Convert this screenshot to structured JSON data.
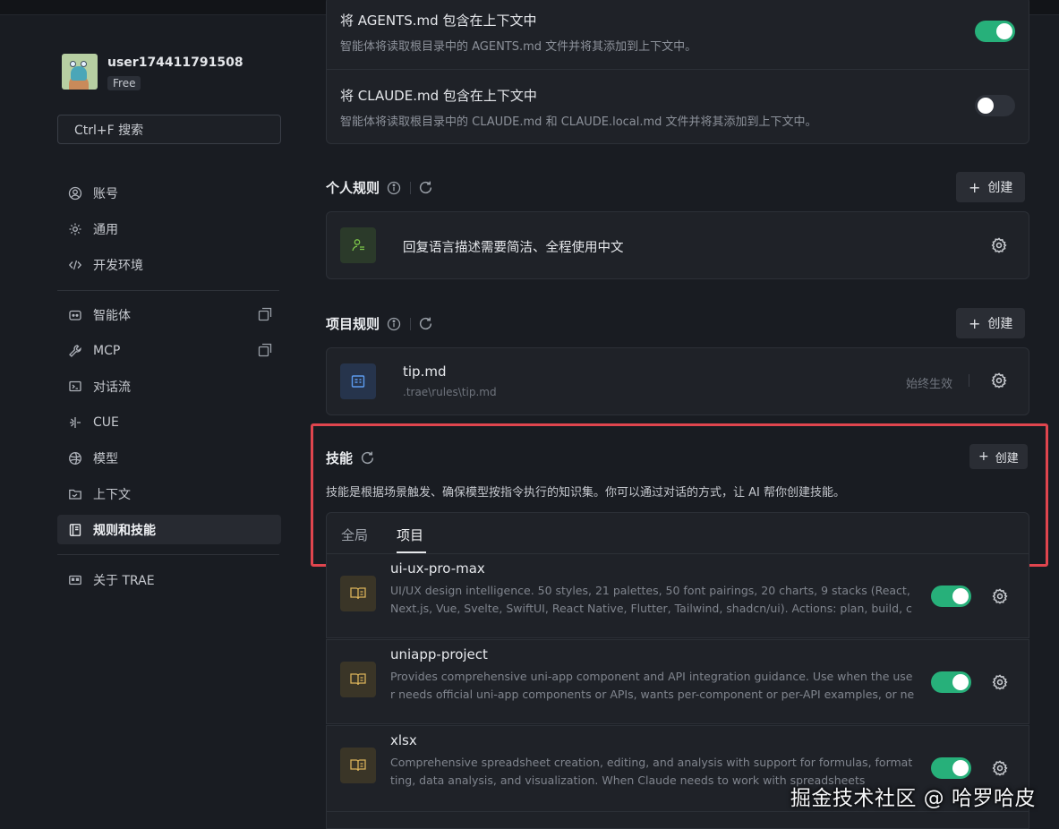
{
  "user": {
    "name": "user174411791508",
    "plan": "Free"
  },
  "search": {
    "label": "Ctrl+F 搜索"
  },
  "nav": {
    "account": "账号",
    "general": "通用",
    "devenv": "开发环境",
    "agents": "智能体",
    "mcp": "MCP",
    "flow": "对话流",
    "cue": "CUE",
    "models": "模型",
    "context": "上下文",
    "rules": "规则和技能",
    "about": "关于 TRAE"
  },
  "context_rows": [
    {
      "title": "将 AGENTS.md 包含在上下文中",
      "desc": "智能体将读取根目录中的 AGENTS.md 文件并将其添加到上下文中。",
      "enabled": true
    },
    {
      "title": "将 CLAUDE.md 包含在上下文中",
      "desc": "智能体将读取根目录中的 CLAUDE.md 和 CLAUDE.local.md 文件并将其添加到上下文中。",
      "enabled": false
    }
  ],
  "personal_rules": {
    "title": "个人规则",
    "create_label": "创建",
    "items": [
      {
        "text": "回复语言描述需要简洁、全程使用中文"
      }
    ]
  },
  "project_rules": {
    "title": "项目规则",
    "create_label": "创建",
    "items": [
      {
        "name": "tip.md",
        "path": ".trae\\rules\\tip.md",
        "status": "始终生效"
      }
    ]
  },
  "skills": {
    "title": "技能",
    "create_label": "创建",
    "desc": "技能是根据场景触发、确保模型按指令执行的知识集。你可以通过对话的方式，让 AI 帮你创建技能。",
    "tabs": [
      "全局",
      "项目"
    ],
    "active_tab": "项目",
    "items": [
      {
        "name": "ui-ux-pro-max",
        "desc": "UI/UX design intelligence. 50 styles, 21 palettes, 50 font pairings, 20 charts, 9 stacks (React, Next.js, Vue, Svelte, SwiftUI, React Native, Flutter, Tailwind, shadcn/ui). Actions: plan, build, create, des...",
        "enabled": true
      },
      {
        "name": "uniapp-project",
        "desc": "Provides comprehensive uni-app component and API integration guidance. Use when the user needs official uni-app components or APIs, wants per-component or per-API examples, or needs...",
        "enabled": true
      },
      {
        "name": "xlsx",
        "desc": "Comprehensive spreadsheet creation, editing, and analysis with support for formulas, formatting, data analysis, and visualization. When Claude needs to work with spreadsheets",
        "enabled": true
      }
    ]
  },
  "watermark": "掘金技术社区 @ 哈罗哈皮",
  "colors": {
    "accent_toggle": "#27b07a",
    "highlight_box": "#e0454e",
    "background": "#191c22"
  }
}
